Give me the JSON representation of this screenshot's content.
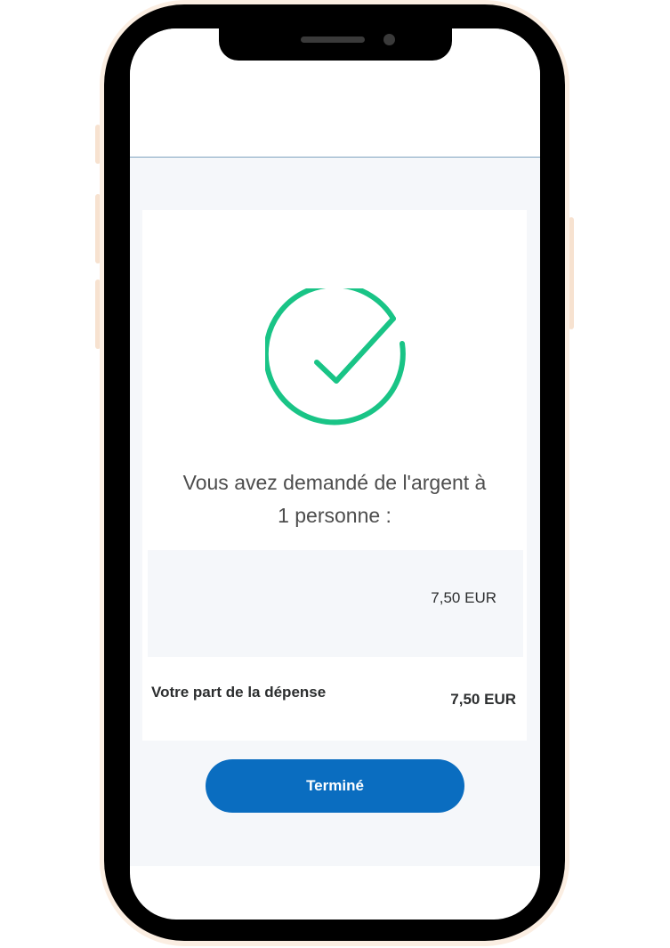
{
  "colors": {
    "success_green": "#19c486",
    "primary_blue": "#0a6dc0",
    "text_dark": "#2c2e2f",
    "text_muted": "#4d4d4d",
    "background_light": "#f5f7fa"
  },
  "confirmation": {
    "icon": "checkmark-circle-icon",
    "message_line1": "Vous avez demandé de l'argent à",
    "message_line2": "1 personne :"
  },
  "recipient": {
    "amount": "7,50 EUR"
  },
  "share": {
    "label": "Votre part de la dépense",
    "amount": "7,50 EUR"
  },
  "actions": {
    "done_label": "Terminé"
  }
}
